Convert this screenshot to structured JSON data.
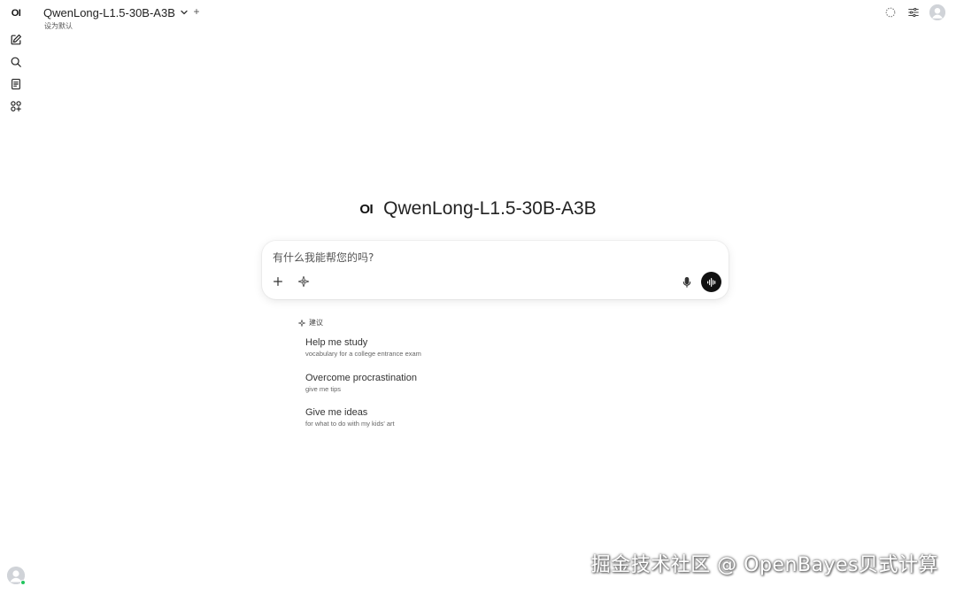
{
  "sidebar": {
    "logo_text": "OI",
    "items": [
      {
        "name": "new-chat",
        "icon": "pencil-square-icon"
      },
      {
        "name": "search",
        "icon": "search-icon"
      },
      {
        "name": "notes",
        "icon": "document-icon"
      },
      {
        "name": "workspace",
        "icon": "grid-icon"
      }
    ],
    "user_status": "online"
  },
  "header": {
    "model_name": "QwenLong-L1.5-30B-A3B",
    "add_model_label": "+",
    "set_default_label": "设为默认",
    "right_icons": [
      "loading-circle-icon",
      "sliders-icon",
      "user-avatar-icon"
    ]
  },
  "hero": {
    "logo_text": "OI",
    "title": "QwenLong-L1.5-30B-A3B"
  },
  "chat": {
    "placeholder": "有什么我能帮您的吗?",
    "value": ""
  },
  "suggestions": {
    "header_label": "建议",
    "items": [
      {
        "title": "Help me study",
        "subtitle": "vocabulary for a college entrance exam"
      },
      {
        "title": "Overcome procrastination",
        "subtitle": "give me tips"
      },
      {
        "title": "Give me ideas",
        "subtitle": "for what to do with my kids' art"
      }
    ]
  },
  "watermark": "掘金技术社区 @ OpenBayes贝式计算",
  "colors": {
    "background": "#ffffff",
    "voice_button": "#111111",
    "online": "#22c55e"
  }
}
